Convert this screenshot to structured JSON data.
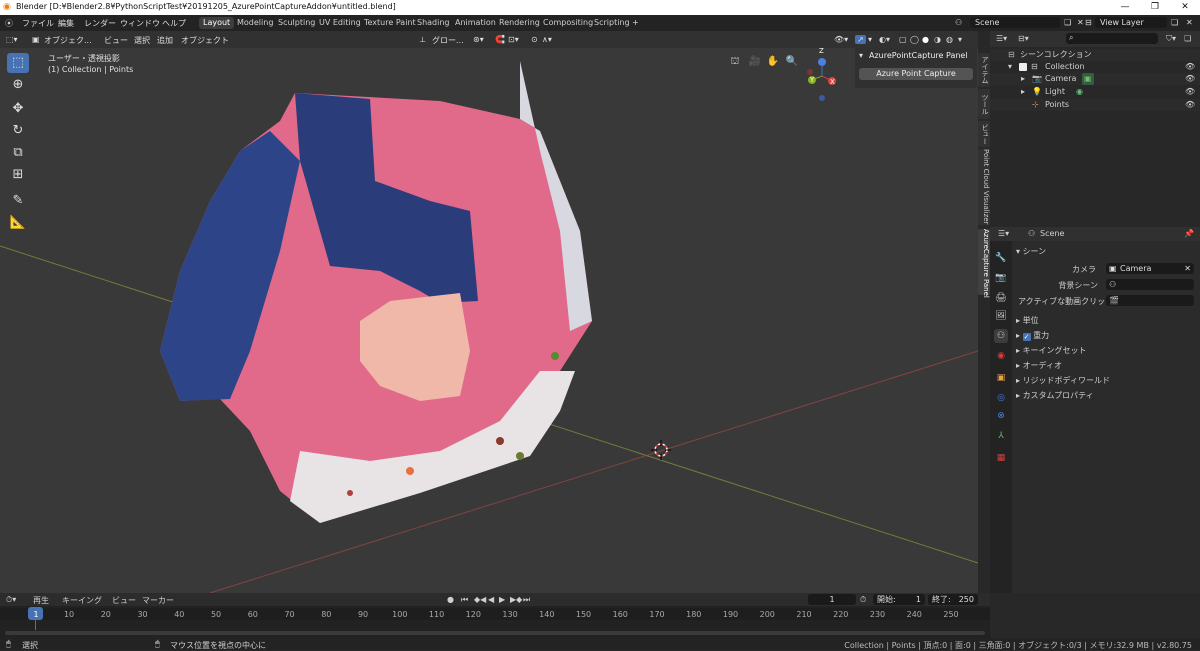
{
  "window": {
    "title": "Blender [D:¥Blender2.8¥PythonScriptTest¥20191205_AzurePointCaptureAddon¥untitled.blend]",
    "minimize": "—",
    "maximize": "❐",
    "close": "✕"
  },
  "menu": {
    "items": [
      "ファイル",
      "編集",
      "レンダー",
      "ウィンドウ",
      "ヘルプ"
    ]
  },
  "workspaces": [
    "Layout",
    "Modeling",
    "Sculpting",
    "UV Editing",
    "Texture Paint",
    "Shading",
    "Animation",
    "Rendering",
    "Compositing",
    "Scripting"
  ],
  "topright": {
    "scene": "Scene",
    "view_layer": "View Layer"
  },
  "viewport": {
    "mode": "オブジェク...",
    "menus": [
      "ビュー",
      "選択",
      "追加",
      "オブジェクト"
    ],
    "transform": "グロー...",
    "view_name": "ユーザー・透視投影",
    "collection_info": "(1) Collection | Points",
    "npanel_title": "AzurePointCapture Panel",
    "npanel_button": "Azure Point Capture",
    "gizmo": {
      "x": "X",
      "y": "Y",
      "z": "Z"
    }
  },
  "side_tabs": [
    "アイテム",
    "ツール",
    "ビュー",
    "Point Cloud Visualizer",
    "AzureCapture Panel"
  ],
  "outliner": {
    "root": "シーンコレクション",
    "collection": "Collection",
    "items": [
      "Camera",
      "Light",
      "Points"
    ]
  },
  "properties": {
    "scene_name": "Scene",
    "section": "シーン",
    "camera_label": "カメラ",
    "camera_value": "Camera",
    "background_label": "背景シーン",
    "movieclip_label": "アクティブな動画クリップ",
    "panels": [
      "単位",
      "重力",
      "キーイングセット",
      "オーディオ",
      "リジッドボディワールド",
      "カスタムプロパティ"
    ]
  },
  "timeline": {
    "menus": [
      "再生",
      "キーイング",
      "ビュー",
      "マーカー"
    ],
    "current_frame": "1",
    "start_label": "開始:",
    "start": "1",
    "end_label": "終了:",
    "end": "250",
    "frames": [
      "1",
      "10",
      "20",
      "30",
      "40",
      "50",
      "60",
      "70",
      "80",
      "90",
      "100",
      "110",
      "120",
      "130",
      "140",
      "150",
      "160",
      "170",
      "180",
      "190",
      "200",
      "210",
      "220",
      "230",
      "240",
      "250"
    ]
  },
  "status": {
    "left": "選択",
    "middle": "マウス位置を視点の中心に",
    "right": "Collection | Points | 頂点:0 | 面:0 | 三角面:0 | オブジェクト:0/3 | メモリ:32.9 MB | v2.80.75"
  },
  "colors": {
    "accent": "#5680c2",
    "active_blue": "#4772b3"
  }
}
